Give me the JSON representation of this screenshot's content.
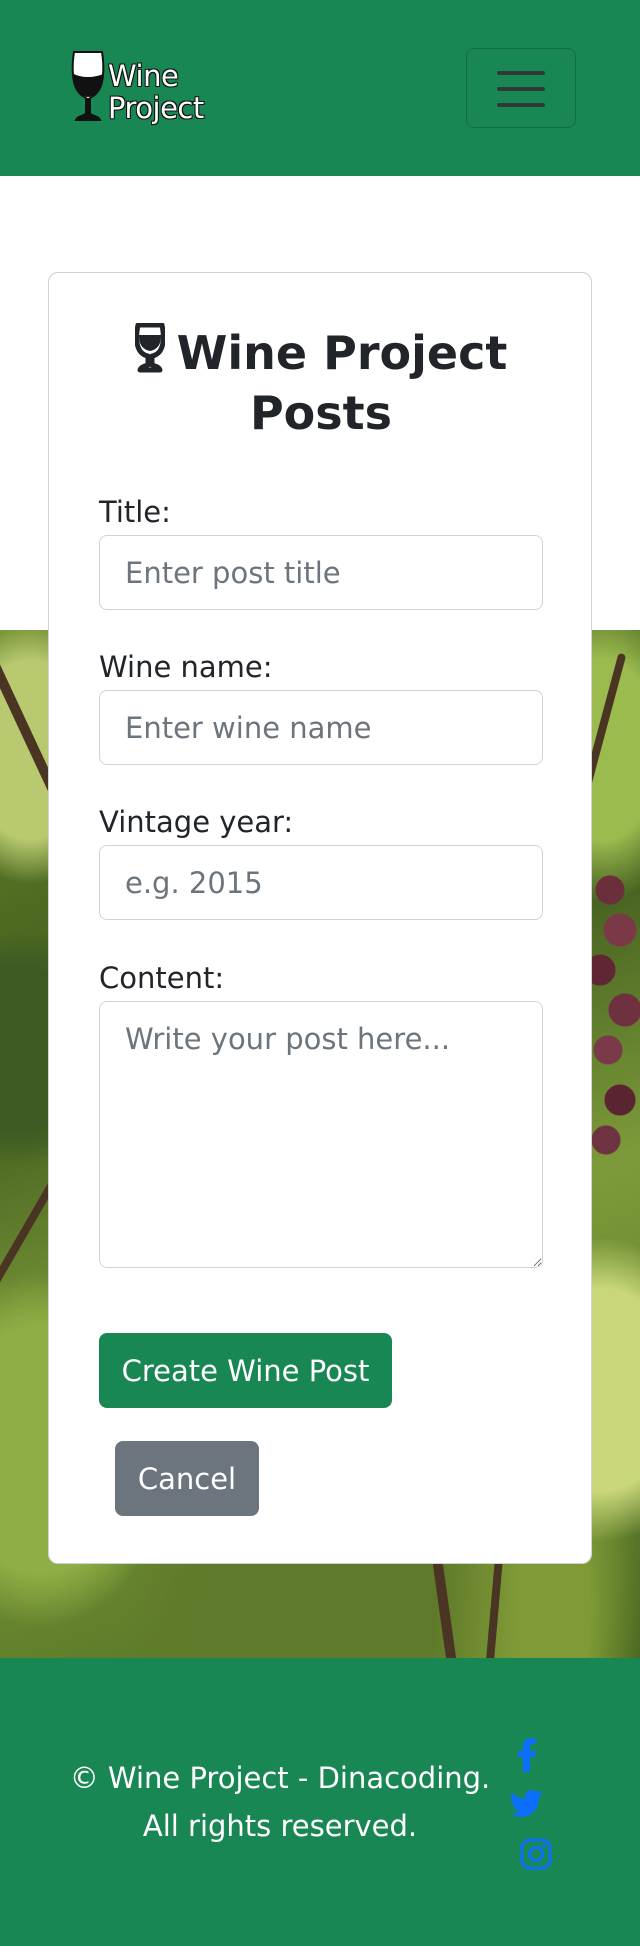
{
  "navbar": {
    "brand_line1": "Wine",
    "brand_line2": "Project",
    "toggler_icon": "hamburger-menu-icon",
    "background": "#198754"
  },
  "card": {
    "title": "Wine Project Posts",
    "title_icon": "wine-glass-icon",
    "fields": {
      "title": {
        "label": "Title:",
        "placeholder": "Enter post title"
      },
      "wine_name": {
        "label": "Wine name:",
        "placeholder": "Enter wine name"
      },
      "vintage_year": {
        "label": "Vintage year:",
        "placeholder": "e.g. 2015"
      },
      "content": {
        "label": "Content:",
        "placeholder": "Write your post here..."
      }
    },
    "create_button": "Create Wine Post",
    "cancel_button": "Cancel"
  },
  "footer": {
    "line1": "© Wine Project - Dinacoding.",
    "line2": "All rights reserved.",
    "social_icons": [
      "facebook-icon",
      "twitter-icon",
      "instagram-icon"
    ],
    "icon_color": "#0d6efd"
  }
}
